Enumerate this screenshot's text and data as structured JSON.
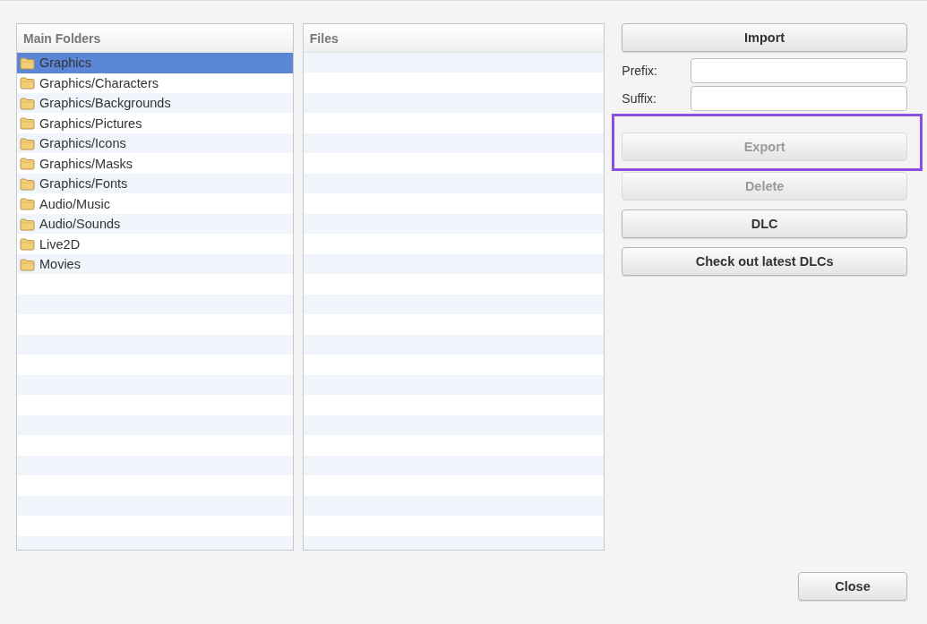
{
  "folders_panel": {
    "header": "Main Folders",
    "items": [
      {
        "label": "Graphics",
        "selected": true
      },
      {
        "label": "Graphics/Characters",
        "selected": false
      },
      {
        "label": "Graphics/Backgrounds",
        "selected": false
      },
      {
        "label": "Graphics/Pictures",
        "selected": false
      },
      {
        "label": "Graphics/Icons",
        "selected": false
      },
      {
        "label": "Graphics/Masks",
        "selected": false
      },
      {
        "label": "Graphics/Fonts",
        "selected": false
      },
      {
        "label": "Audio/Music",
        "selected": false
      },
      {
        "label": "Audio/Sounds",
        "selected": false
      },
      {
        "label": "Live2D",
        "selected": false
      },
      {
        "label": "Movies",
        "selected": false
      }
    ]
  },
  "files_panel": {
    "header": "Files"
  },
  "import_button": {
    "label": "Import",
    "disabled": false
  },
  "fields": [
    {
      "label": "Prefix:"
    },
    {
      "label": "Suffix:"
    }
  ],
  "buttons": [
    {
      "label": "Export",
      "disabled": true,
      "highlighted": true
    },
    {
      "label": "Delete",
      "disabled": true,
      "highlighted": false
    },
    {
      "label": "DLC",
      "disabled": false,
      "highlighted": false
    },
    {
      "label": "Check out latest DLCs",
      "disabled": false,
      "highlighted": false
    }
  ],
  "close_button": {
    "label": "Close",
    "disabled": false
  }
}
